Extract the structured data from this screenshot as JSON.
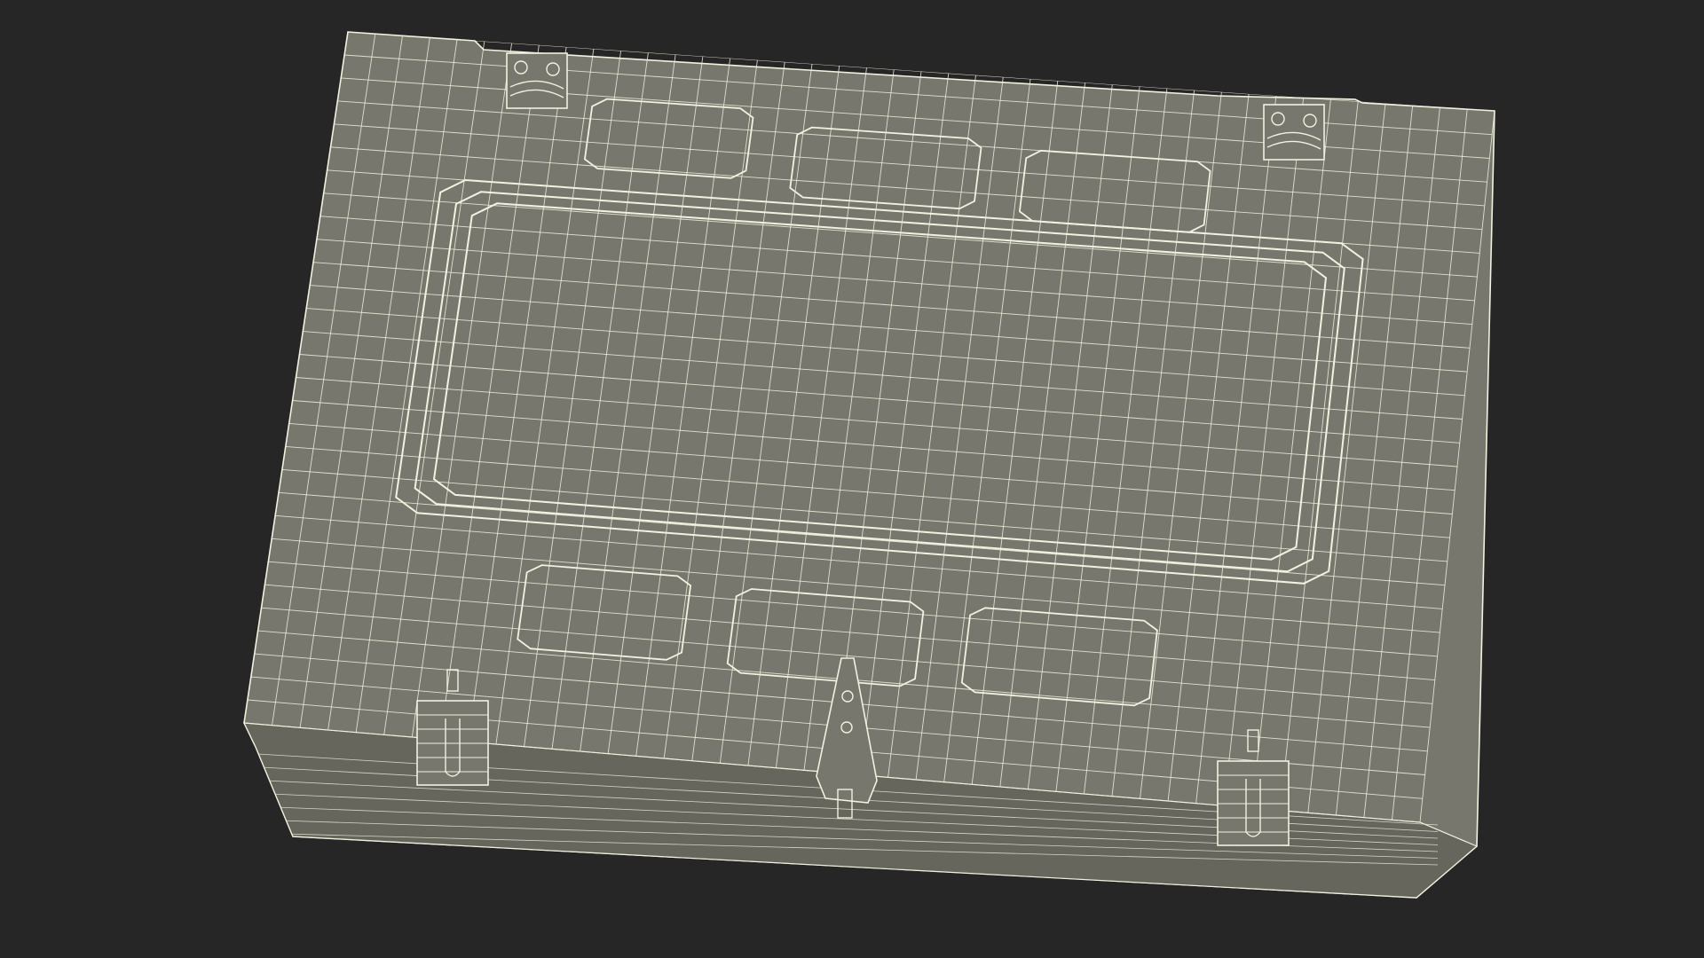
{
  "scene": {
    "subject": "wireframe-case",
    "background_color": "#262626",
    "model_fill": "#77776d",
    "model_fill_dark": "#66665d",
    "wire_color": "#f1f2df"
  }
}
